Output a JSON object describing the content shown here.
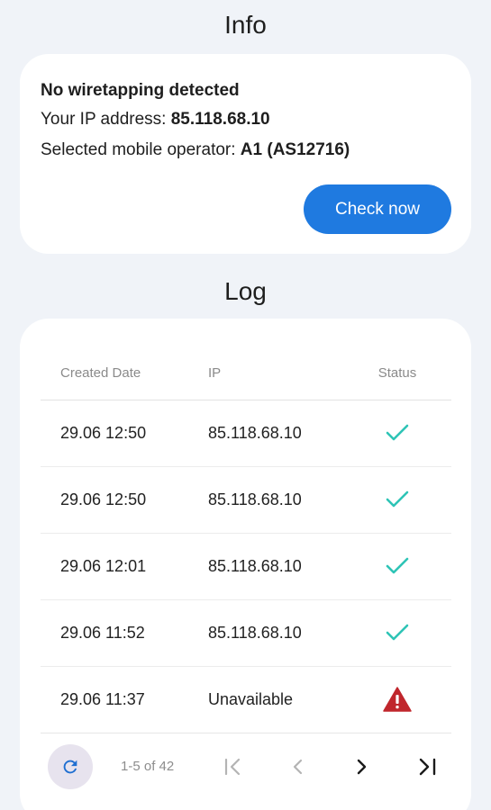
{
  "info": {
    "title": "Info",
    "status_text": "No wiretapping detected",
    "ip_label": "Your IP address: ",
    "ip_value": "85.118.68.10",
    "operator_label": "Selected mobile operator: ",
    "operator_value": "A1 (AS12716)",
    "check_button": "Check now"
  },
  "log": {
    "title": "Log",
    "columns": [
      "Created Date",
      "IP",
      "Status"
    ],
    "rows": [
      {
        "date": "29.06 12:50",
        "ip": "85.118.68.10",
        "status": "ok",
        "status_icon": "check-icon"
      },
      {
        "date": "29.06 12:50",
        "ip": "85.118.68.10",
        "status": "ok",
        "status_icon": "check-icon"
      },
      {
        "date": "29.06 12:01",
        "ip": "85.118.68.10",
        "status": "ok",
        "status_icon": "check-icon"
      },
      {
        "date": "29.06 11:52",
        "ip": "85.118.68.10",
        "status": "ok",
        "status_icon": "check-icon"
      },
      {
        "date": "29.06 11:37",
        "ip": "Unavailable",
        "status": "warning",
        "status_icon": "warning-icon"
      }
    ],
    "pagination": {
      "range_text": "1-5 of 42",
      "refresh_icon": "refresh-icon",
      "first_icon": "first-page-icon",
      "prev_icon": "chevron-left-icon",
      "next_icon": "chevron-right-icon",
      "last_icon": "last-page-icon"
    }
  },
  "colors": {
    "background": "#f0f3f8",
    "accent": "#1f7ae0",
    "ok": "#2ec4b6",
    "warning": "#c0262c",
    "refresh_bg": "#e7e3ee"
  }
}
